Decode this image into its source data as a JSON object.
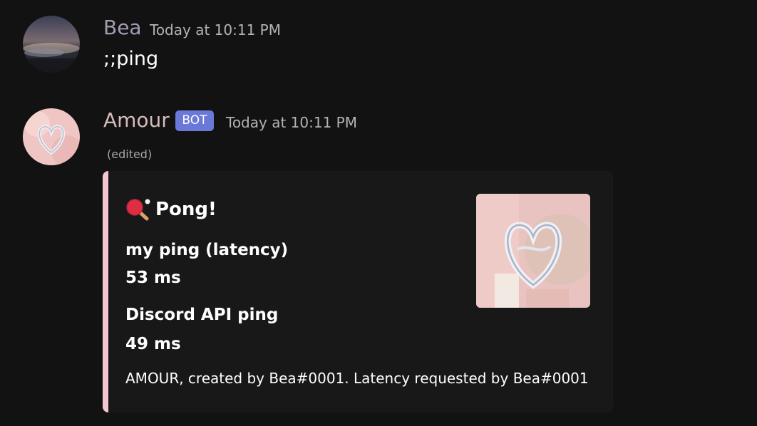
{
  "messages": [
    {
      "author": "Bea",
      "timestamp": "Today at 10:11 PM",
      "content": ";;ping",
      "author_color": "#a59bb5"
    },
    {
      "author": "Amour",
      "badge": "BOT",
      "timestamp": "Today at 10:11 PM",
      "edited": "(edited)",
      "author_color": "#d7bcbc",
      "embed": {
        "accent_color": "#f5c6cf",
        "title_icon": "ping-pong-icon",
        "title": "Pong!",
        "fields": [
          {
            "name": "my ping (latency)",
            "value": "53 ms"
          },
          {
            "name": "Discord API ping",
            "value": "49 ms"
          }
        ],
        "footer": "AMOUR, created by Bea#0001. Latency requested by Bea#0001",
        "thumbnail": "heart-logo-thumbnail"
      }
    }
  ]
}
